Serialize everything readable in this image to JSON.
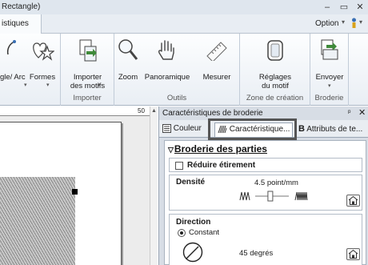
{
  "window": {
    "title": "Rectangle)",
    "controls": {
      "minimize": "–",
      "maximize": "▭",
      "close": "✕"
    }
  },
  "ribbon_tabs": {
    "active": "istiques",
    "option": "Option"
  },
  "ribbon": {
    "groups": [
      {
        "label": "",
        "buttons": [
          {
            "label": "gle/\nArc",
            "icon": "arc-icon",
            "dropdown": true
          },
          {
            "label": "Formes",
            "icon": "heart-star-icon",
            "dropdown": true
          }
        ]
      },
      {
        "label": "Importer",
        "buttons": [
          {
            "label": "Importer\ndes motifs",
            "icon": "import-icon",
            "dropdown": true
          }
        ]
      },
      {
        "label": "Outils",
        "buttons": [
          {
            "label": "Zoom",
            "icon": "magnifier-icon"
          },
          {
            "label": "Panoramique",
            "icon": "hand-icon"
          },
          {
            "label": "Mesurer",
            "icon": "ruler-icon"
          }
        ]
      },
      {
        "label": "Zone de création",
        "buttons": [
          {
            "label": "Réglages\ndu motif",
            "icon": "hoop-icon"
          }
        ]
      },
      {
        "label": "Broderie",
        "buttons": [
          {
            "label": "Envoyer",
            "icon": "send-icon",
            "dropdown": true
          }
        ]
      }
    ]
  },
  "canvas": {
    "ruler_mark": "50"
  },
  "panel": {
    "title": "Caractéristiques de broderie",
    "pin": "ᵖ",
    "close": "✕",
    "tabs": [
      {
        "label": "Couleur",
        "icon": "color-icon"
      },
      {
        "label": "Caractéristique...",
        "icon": "stitch-icon",
        "active": true
      },
      {
        "label": "Attributs de te...",
        "icon": "b-icon"
      }
    ],
    "section_title": "Broderie des parties",
    "reduce_stretch": "Réduire étirement",
    "density": {
      "label": "Densité",
      "value": "4.5 point/mm",
      "slider_level": 0.45
    },
    "direction": {
      "label": "Direction",
      "mode": "Constant",
      "angle": "45 degrés"
    }
  }
}
